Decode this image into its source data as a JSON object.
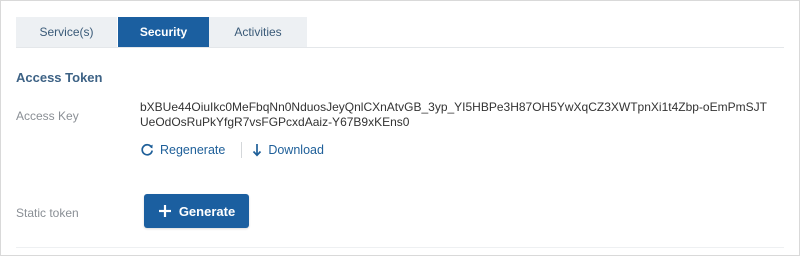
{
  "tabs": [
    {
      "label": "Service(s)",
      "active": false
    },
    {
      "label": "Security",
      "active": true
    },
    {
      "label": "Activities",
      "active": false
    }
  ],
  "section": {
    "title": "Access Token"
  },
  "access_key": {
    "label": "Access Key",
    "value": "bXBUe44OiuIkc0MeFbqNn0NduosJeyQnlCXnAtvGB_3yp_YI5HBPe3H87OH5YwXqCZ3XWTpnXi1t4Zbp-oEmPmSJTUeOdOsRuPkYfgR7vsFGPcxdAaiz-Y67B9xKEns0",
    "actions": {
      "regenerate": "Regenerate",
      "download": "Download"
    }
  },
  "static_token": {
    "label": "Static token",
    "button": "Generate"
  },
  "colors": {
    "accent": "#1b5fa0",
    "link": "#1e5f99",
    "section_title": "#3d6285",
    "muted_label": "#8a8f95"
  },
  "icons": {
    "regenerate": "refresh-icon",
    "download": "download-arrow-icon",
    "generate": "plus-icon"
  }
}
